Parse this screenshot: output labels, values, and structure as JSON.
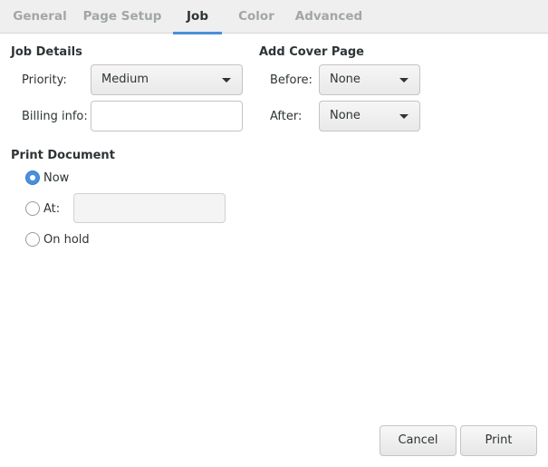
{
  "tabs": [
    "General",
    "Page Setup",
    "Job",
    "Color",
    "Advanced"
  ],
  "job_details": {
    "heading": "Job Details",
    "priority_label": "Priority:",
    "priority_value": "Medium",
    "billing_label": "Billing info:",
    "billing_value": ""
  },
  "cover_page": {
    "heading": "Add Cover Page",
    "before_label": "Before:",
    "before_value": "None",
    "after_label": "After:",
    "after_value": "None"
  },
  "print_document": {
    "heading": "Print Document",
    "options": [
      "Now",
      "At:",
      "On hold"
    ],
    "selected": "Now",
    "at_time_value": ""
  },
  "buttons": {
    "cancel": "Cancel",
    "print": "Print"
  },
  "colors": {
    "accent": "#4a90d9",
    "tab_inactive": "#a2a6a6",
    "text": "#2e3436"
  },
  "icons": {
    "dropdown": "chevron-down-icon"
  }
}
